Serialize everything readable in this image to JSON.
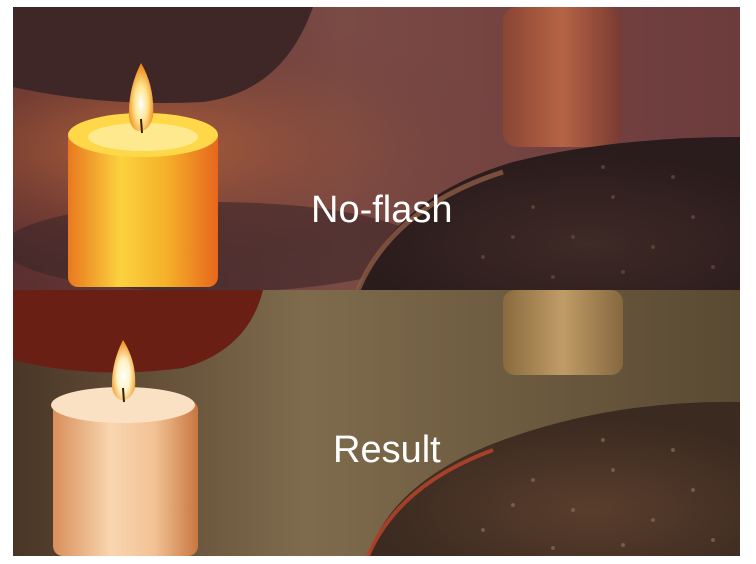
{
  "panels": {
    "top": {
      "caption": "No-flash"
    },
    "bottom": {
      "caption": "Result"
    }
  },
  "palette": {
    "top_background": "#6a3a35",
    "top_flame": "#ffe38a",
    "top_candle": "#f7b133",
    "bottom_background": "#8a7656",
    "bottom_flame": "#fff3c4",
    "bottom_candle": "#f4c9a0",
    "caption_color": "#ffffff"
  }
}
